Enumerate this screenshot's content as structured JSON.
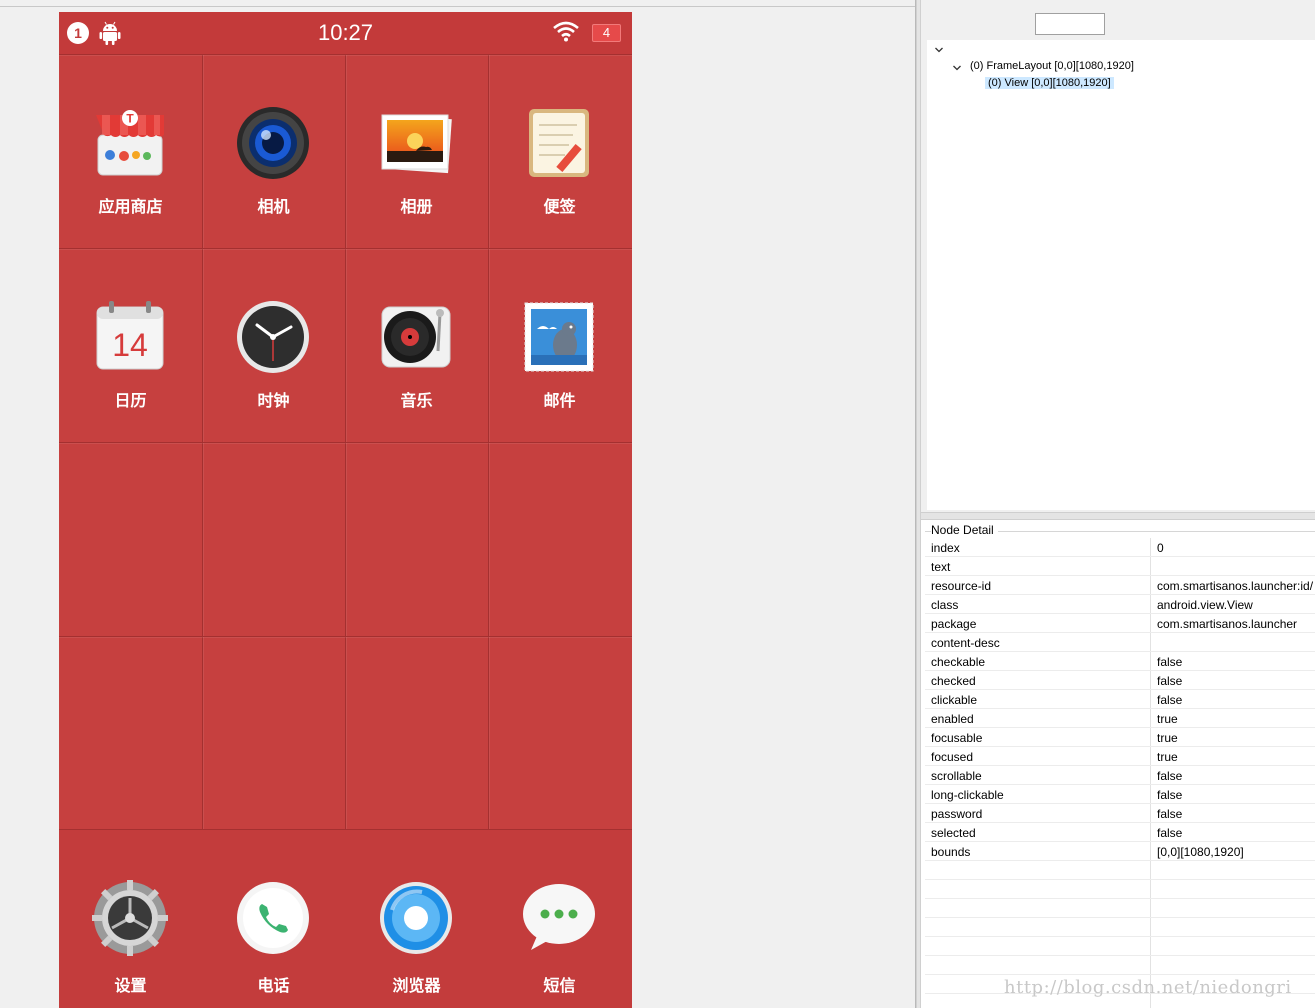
{
  "phone": {
    "status_bar": {
      "notification_count": "1",
      "time": "10:27",
      "battery": "4"
    },
    "apps": [
      {
        "label": "应用商店",
        "icon": "app-store-icon"
      },
      {
        "label": "相机",
        "icon": "camera-icon"
      },
      {
        "label": "相册",
        "icon": "gallery-icon"
      },
      {
        "label": "便签",
        "icon": "notes-icon"
      },
      {
        "label": "日历",
        "icon": "calendar-icon",
        "calendar_day": "14"
      },
      {
        "label": "时钟",
        "icon": "clock-icon"
      },
      {
        "label": "音乐",
        "icon": "music-icon"
      },
      {
        "label": "邮件",
        "icon": "mail-icon"
      }
    ],
    "dock": [
      {
        "label": "设置",
        "icon": "settings-gear-icon"
      },
      {
        "label": "电话",
        "icon": "phone-icon"
      },
      {
        "label": "浏览器",
        "icon": "browser-icon"
      },
      {
        "label": "短信",
        "icon": "messages-icon"
      }
    ],
    "colors": {
      "background": "#c6403f",
      "accent": "#e64a4a"
    }
  },
  "tree": {
    "rows": [
      "(0) FrameLayout [0,0][1080,1920]",
      "(0) View [0,0][1080,1920]"
    ]
  },
  "node_detail": {
    "title": "Node Detail",
    "rows": [
      {
        "key": "index",
        "value": "0"
      },
      {
        "key": "text",
        "value": ""
      },
      {
        "key": "resource-id",
        "value": "com.smartisanos.launcher:id/"
      },
      {
        "key": "class",
        "value": "android.view.View"
      },
      {
        "key": "package",
        "value": "com.smartisanos.launcher"
      },
      {
        "key": "content-desc",
        "value": ""
      },
      {
        "key": "checkable",
        "value": "false"
      },
      {
        "key": "checked",
        "value": "false"
      },
      {
        "key": "clickable",
        "value": "false"
      },
      {
        "key": "enabled",
        "value": "true"
      },
      {
        "key": "focusable",
        "value": "true"
      },
      {
        "key": "focused",
        "value": "true"
      },
      {
        "key": "scrollable",
        "value": "false"
      },
      {
        "key": "long-clickable",
        "value": "false"
      },
      {
        "key": "password",
        "value": "false"
      },
      {
        "key": "selected",
        "value": "false"
      },
      {
        "key": "bounds",
        "value": "[0,0][1080,1920]"
      }
    ]
  },
  "watermark": "http://blog.csdn.net/niedongri"
}
